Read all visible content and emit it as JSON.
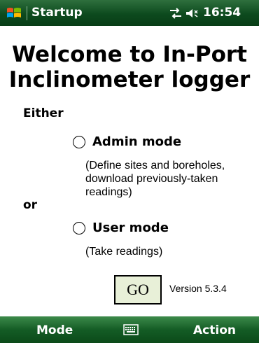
{
  "titlebar": {
    "title": "Startup",
    "time": "16:54",
    "icons": [
      "windows-start-icon",
      "connectivity-icon",
      "volume-icon"
    ]
  },
  "main": {
    "heading_line1": "Welcome to In-Port",
    "heading_line2": "Inclinometer logger",
    "either_label": "Either",
    "or_label": "or",
    "admin": {
      "label": "Admin mode",
      "desc_line1": "(Define sites and boreholes,",
      "desc_line2": "download previously-taken",
      "desc_line3": "readings)",
      "selected": false
    },
    "user": {
      "label": "User mode",
      "desc": "(Take readings)",
      "selected": false
    },
    "go_label": "GO",
    "version": "Version 5.3.4"
  },
  "softkeys": {
    "left": "Mode",
    "right": "Action",
    "center_icon": "keyboard-icon"
  },
  "colors": {
    "bar_green": "#0d4a1e",
    "go_bg": "#e8f0d8"
  }
}
